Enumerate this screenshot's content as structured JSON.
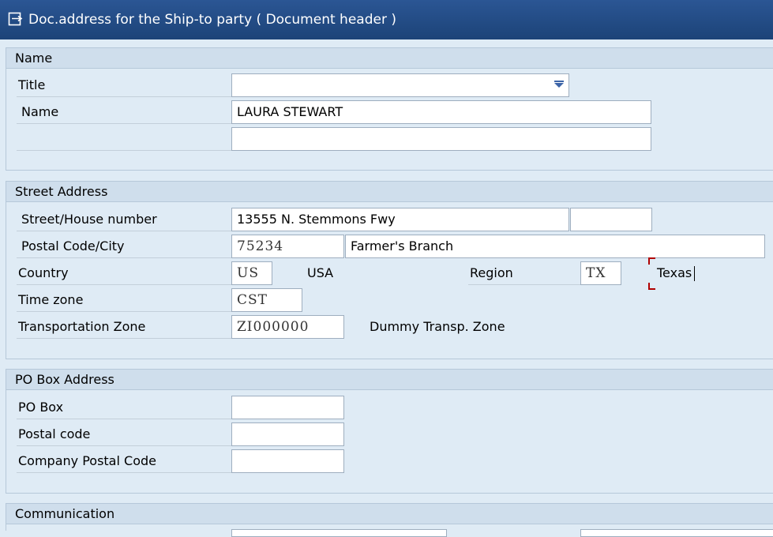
{
  "window": {
    "title": "Doc.address for the Ship-to party ( Document header )"
  },
  "name_group": {
    "heading": "Name",
    "title_label": "Title",
    "title_value": "",
    "name_label": "Name",
    "name_value": "LAURA STEWART",
    "name2_value": ""
  },
  "street_group": {
    "heading": "Street Address",
    "street_label": "Street/House number",
    "street_value": "13555 N. Stemmons Fwy",
    "house_number_value": "",
    "postal_label": "Postal Code/City",
    "postal_value": "75234",
    "city_value": "Farmer's Branch",
    "country_label": "Country",
    "country_value": "US",
    "country_text": "USA",
    "region_label": "Region",
    "region_value": "TX",
    "region_text": "Texas",
    "timezone_label": "Time zone",
    "timezone_value": "CST",
    "transport_label": "Transportation Zone",
    "transport_value": "ZI000000",
    "transport_text": "Dummy Transp. Zone"
  },
  "pobox_group": {
    "heading": "PO Box Address",
    "pobox_label": "PO Box",
    "pobox_value": "",
    "postal_code_label": "Postal code",
    "postal_code_value": "",
    "company_postal_label": "Company Postal Code",
    "company_postal_value": ""
  },
  "communication_group": {
    "heading": "Communication"
  }
}
